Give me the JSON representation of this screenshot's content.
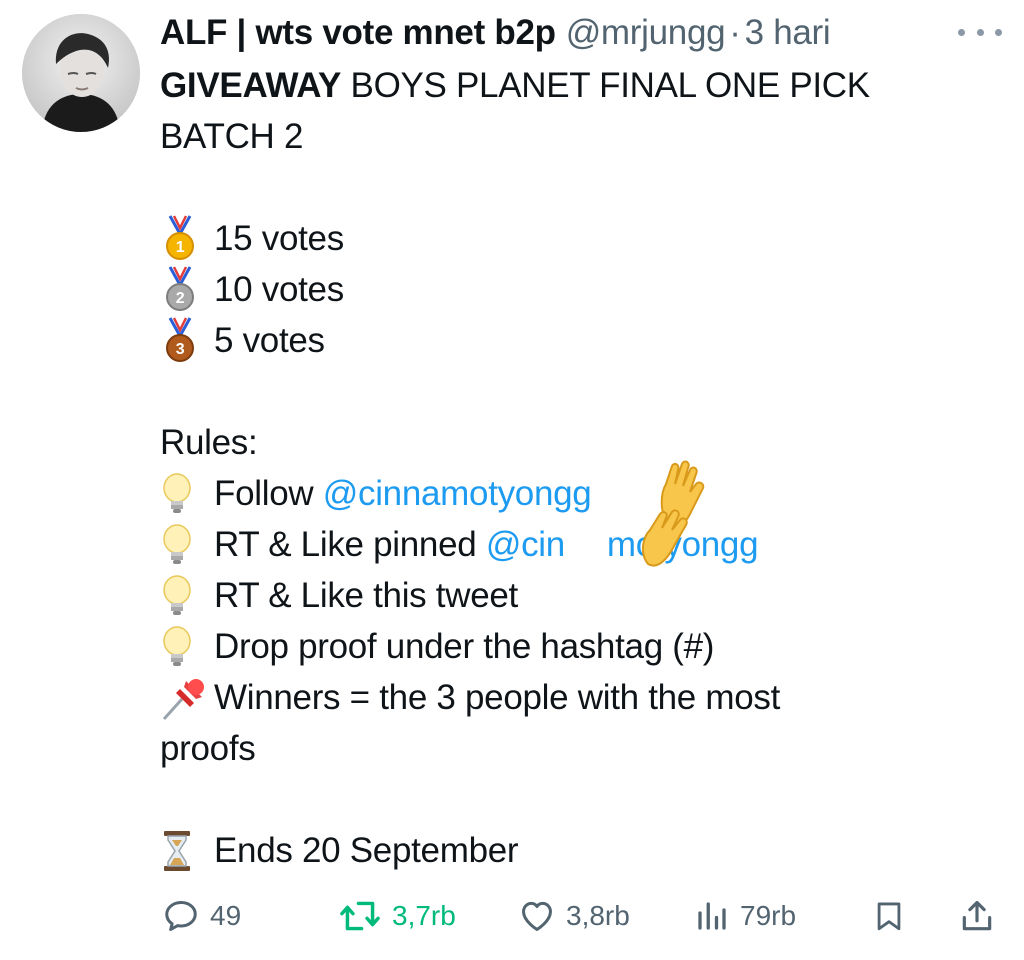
{
  "tweet": {
    "display_name": "ALF | wts vote mnet b2p",
    "handle": "@mrjungg",
    "separator": "·",
    "time": "3 hari",
    "line1_bold": "GIVEAWAY",
    "line1_rest": " BOYS PLANET FINAL ONE PICK",
    "line2": "BATCH 2",
    "prize1": "15 votes",
    "prize2": "10 votes",
    "prize3": "5 votes",
    "rules_heading": "Rules:",
    "rule1_text": "Follow ",
    "rule1_mention": "@cinnamotyongg",
    "rule2_text": "RT & Like pinned ",
    "rule2_mention_a": "@cin",
    "rule2_mention_b": "motyongg",
    "rule3": "RT & Like this tweet",
    "rule4": "Drop proof under the hashtag (#)",
    "rule5_line1": "Winners = the 3 people with the most",
    "rule5_line2": "proofs",
    "ends": "Ends 20 September"
  },
  "actions": {
    "replies": "49",
    "retweets": "3,7rb",
    "likes": "3,8rb",
    "views": "79rb"
  },
  "colors": {
    "link": "#1d9bf0",
    "retweet": "#00ba7c",
    "muted": "#536471",
    "text": "#0f1419"
  },
  "icons": [
    "avatar",
    "more-icon",
    "gold-medal-icon",
    "silver-medal-icon",
    "bronze-medal-icon",
    "light-bulb-icon",
    "pushpin-icon",
    "hourglass-icon",
    "clapping-hands-icon",
    "reply-icon",
    "retweet-icon",
    "like-icon",
    "views-icon",
    "bookmark-icon",
    "share-icon"
  ]
}
